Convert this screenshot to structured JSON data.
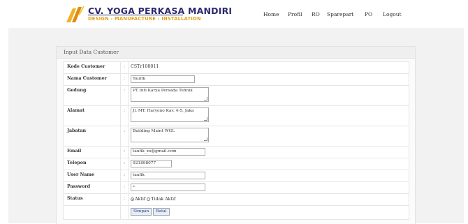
{
  "brand": {
    "title": "CV. YOGA PERKASA MANDIRI",
    "tagline": "DESIGN - MANUFACTURE - INSTALLATION"
  },
  "nav": [
    {
      "label": "Home"
    },
    {
      "label": "Profil"
    },
    {
      "label": "RO"
    },
    {
      "label": "Sparepart"
    },
    {
      "label": "PO"
    },
    {
      "label": "Logout"
    }
  ],
  "panel": {
    "title": "Input Data Customer"
  },
  "form": {
    "separator": ":",
    "kode": {
      "label": "Kode Customer",
      "value": "CSTr108011"
    },
    "nama": {
      "label": "Nama Customer",
      "value": "Taufik"
    },
    "gedung": {
      "label": "Gedung",
      "value": "PT Inti Karya Persada Tehnik"
    },
    "alamat": {
      "label": "Alamat",
      "value": "Jl. MT. Haryono Kav. 4-5, Jaka"
    },
    "jabatan": {
      "label": "Jabatan",
      "value": "Building Maint WGL"
    },
    "email": {
      "label": "Email",
      "value": "taufik_xx@gmail.com"
    },
    "telepon": {
      "label": "Telepon",
      "value": "021898077"
    },
    "username": {
      "label": "User Name",
      "value": "taufik"
    },
    "password": {
      "label": "Password",
      "value": "•"
    },
    "status": {
      "label": "Status",
      "option_active": "Aktif",
      "option_inactive": "Tidak Aktif",
      "selected": "Aktif"
    },
    "buttons": {
      "save": "Simpan",
      "reset": "Batal"
    }
  },
  "colors": {
    "brand_blue": "#2b2a6e",
    "brand_orange": "#e3a21a",
    "button_text": "#1f3f8a"
  }
}
